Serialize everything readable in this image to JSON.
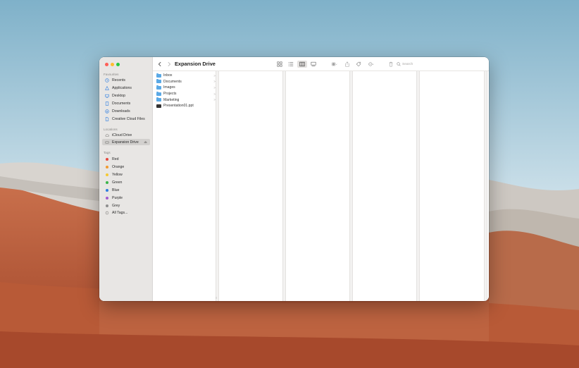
{
  "window": {
    "title": "Expansion Drive"
  },
  "sidebar": {
    "favourites_label": "Favourites",
    "favourites": [
      {
        "label": "Recents",
        "icon": "clock-icon"
      },
      {
        "label": "Applications",
        "icon": "applications-icon"
      },
      {
        "label": "Desktop",
        "icon": "desktop-icon"
      },
      {
        "label": "Documents",
        "icon": "document-icon"
      },
      {
        "label": "Downloads",
        "icon": "download-icon"
      },
      {
        "label": "Creative Cloud Files",
        "icon": "file-icon"
      }
    ],
    "locations_label": "Locations",
    "locations": [
      {
        "label": "iCloud Drive",
        "icon": "cloud-icon"
      },
      {
        "label": "Expansion Drive",
        "icon": "drive-icon",
        "selected": true,
        "eject": "⏏"
      }
    ],
    "tags_label": "Tags",
    "tags": [
      {
        "label": "Red",
        "color": "#e5483f"
      },
      {
        "label": "Orange",
        "color": "#f29a2e"
      },
      {
        "label": "Yellow",
        "color": "#f5c932"
      },
      {
        "label": "Green",
        "color": "#3bb54a"
      },
      {
        "label": "Blue",
        "color": "#2f7ee0"
      },
      {
        "label": "Purple",
        "color": "#a45bd0"
      },
      {
        "label": "Grey",
        "color": "#8e8e8e"
      }
    ],
    "all_tags": "All Tags..."
  },
  "toolbar": {
    "search_placeholder": "Search"
  },
  "files": [
    {
      "name": "Inbox",
      "type": "folder",
      "chevron": ">"
    },
    {
      "name": "Documents",
      "type": "folder",
      "chevron": ">"
    },
    {
      "name": "Images",
      "type": "folder",
      "chevron": ">"
    },
    {
      "name": "Projects",
      "type": "folder",
      "chevron": ">"
    },
    {
      "name": "Marketing",
      "type": "folder",
      "chevron": ">"
    },
    {
      "name": "Presentation01.ppt",
      "type": "file"
    }
  ],
  "colors": {
    "accent": "#5aa9e6",
    "sidebar_bg": "#e8e6e4"
  }
}
